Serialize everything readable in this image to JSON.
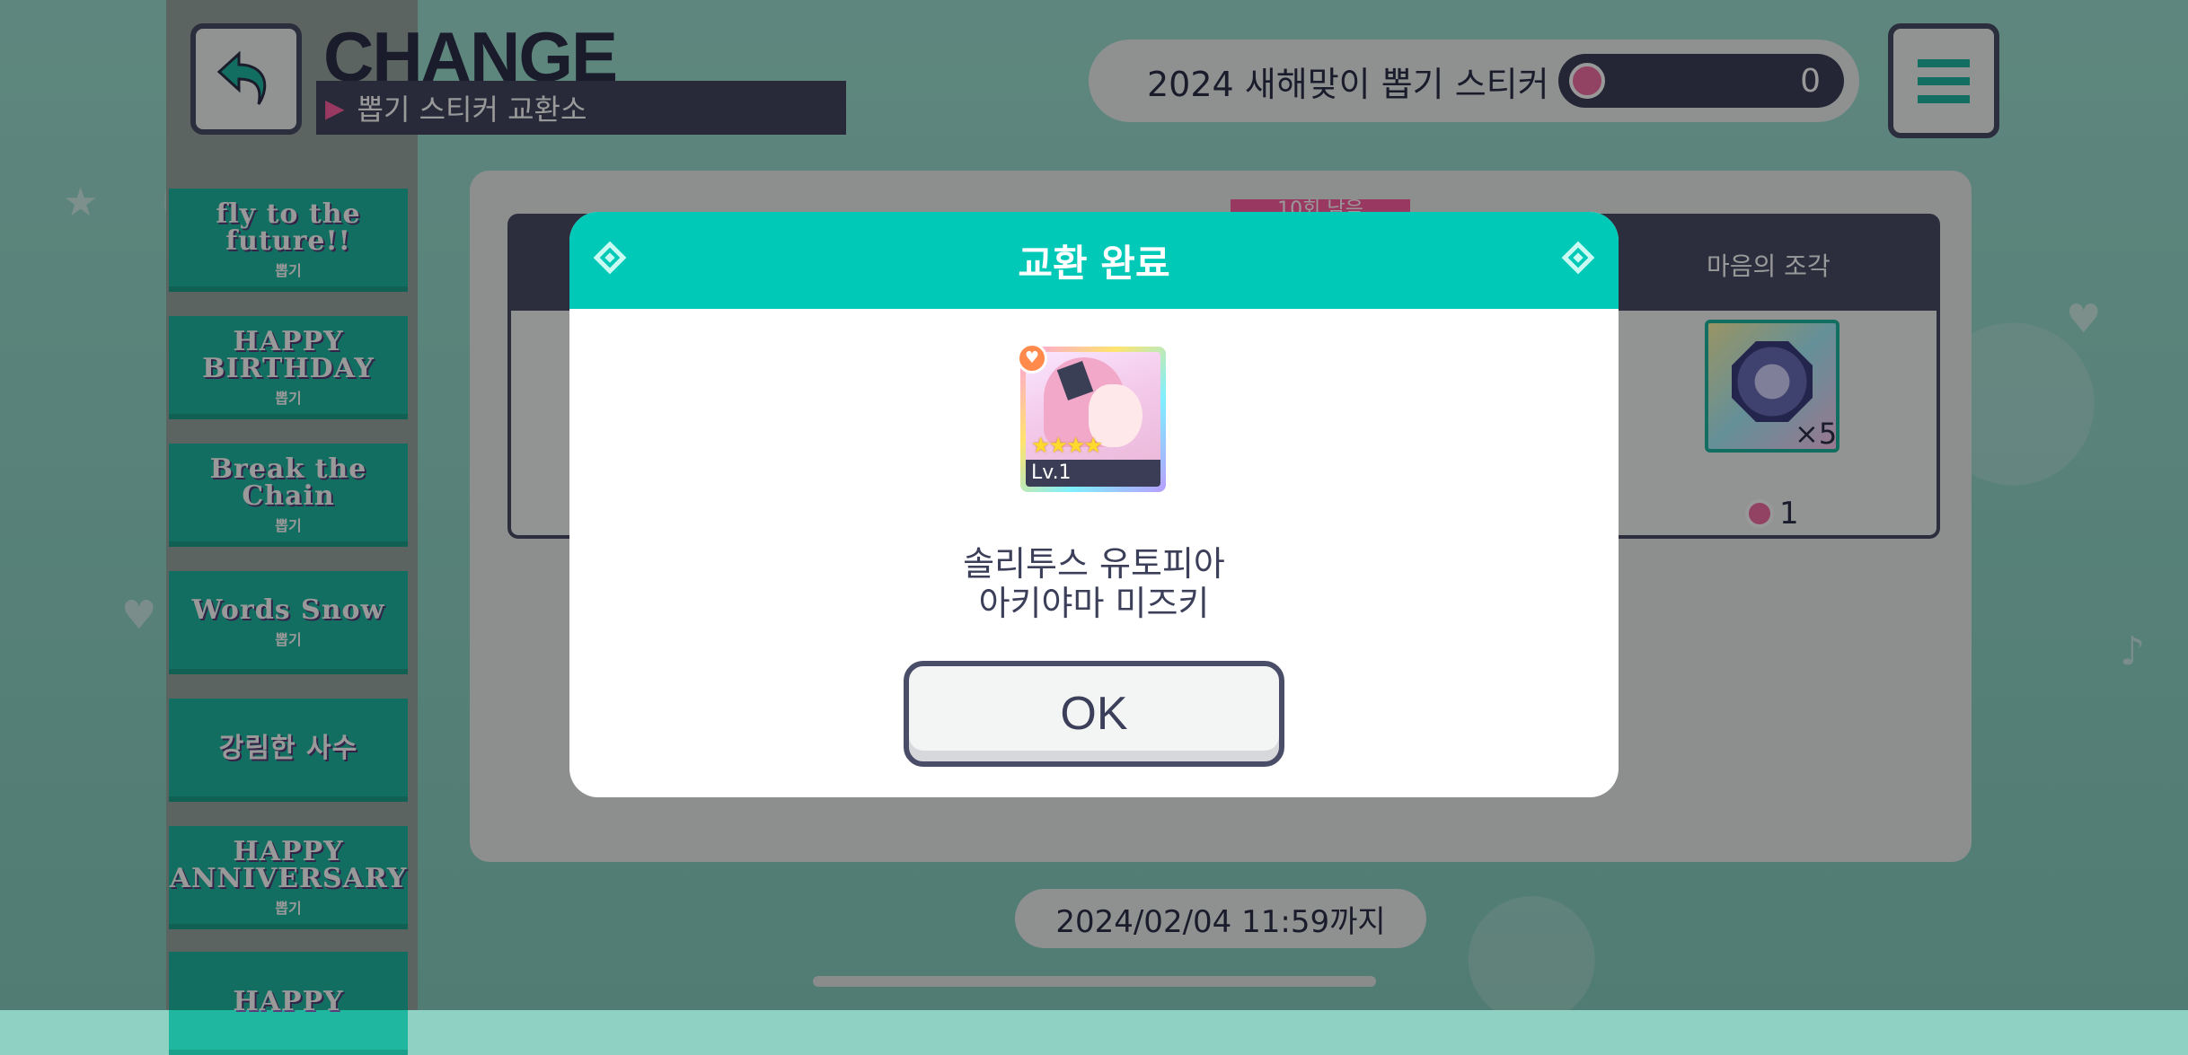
{
  "header": {
    "title": "CHANGE",
    "subtitle": "뽑기 스티커 교환소",
    "sticker_name": "2024 새해맞이 뽑기 스티커",
    "sticker_count": "0"
  },
  "sidebar": {
    "banners": [
      {
        "main": "fly to the future!!",
        "sub": "뽑기"
      },
      {
        "main": "HAPPY BIRTHDAY",
        "sub": "뽑기"
      },
      {
        "main": "Break the Chain",
        "sub": "뽑기"
      },
      {
        "main": "Words Snow",
        "sub": "뽑기"
      },
      {
        "main": "강림한 사수",
        "sub": ""
      },
      {
        "main": "HAPPY ANNIVERSARY",
        "sub": "뽑기"
      },
      {
        "main": "HAPPY",
        "sub": ""
      }
    ]
  },
  "table": {
    "tag": "10회 남음",
    "column_label": "마음의 조각",
    "item_qty": "×5",
    "cost": "1"
  },
  "footer": {
    "deadline": "2024/02/04 11:59까지"
  },
  "modal": {
    "title": "교환 완료",
    "card_level": "Lv.1",
    "card_stars": "★★★★",
    "character_line1": "솔리투스 유토피아",
    "character_line2": "아키야마 미즈키",
    "ok_label": "OK"
  },
  "colors": {
    "accent": "#00c9b8",
    "dark": "#4a4d67",
    "pink": "#f46fa6"
  }
}
